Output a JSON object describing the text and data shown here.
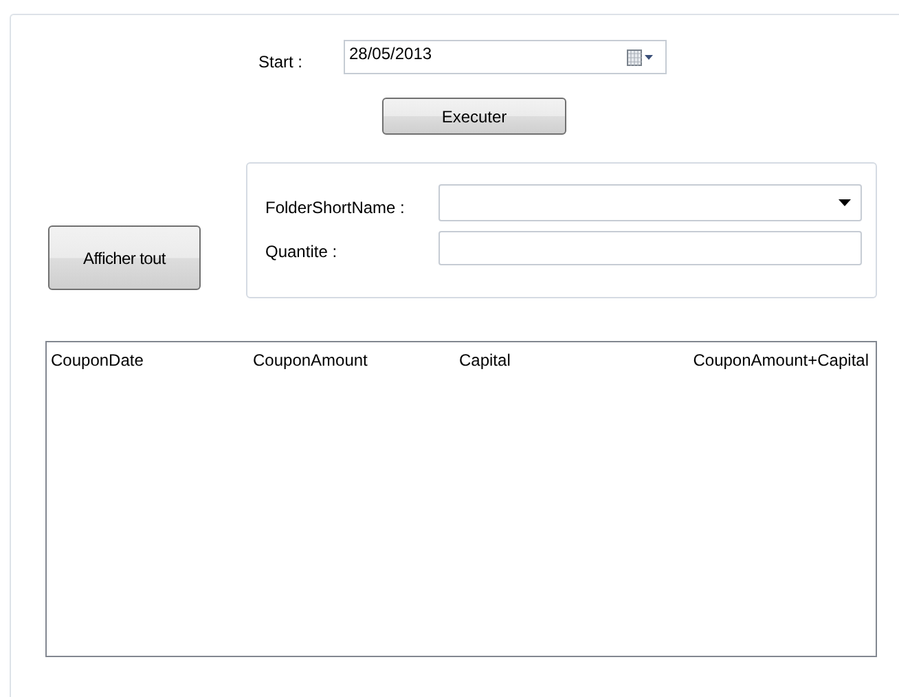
{
  "start": {
    "label": "Start :",
    "value": "28/05/2013"
  },
  "execute_button": "Executer",
  "show_all_button": "Afficher tout",
  "filter": {
    "fields": [
      {
        "kind": "combo",
        "label": "FolderShortName :"
      },
      {
        "kind": "text",
        "label": "Quantite :"
      }
    ]
  },
  "table": {
    "columns": [
      {
        "label": "CouponDate",
        "right_aligned": false
      },
      {
        "label": "CouponAmount",
        "right_aligned": false
      },
      {
        "label": "Capital",
        "right_aligned": false
      },
      {
        "label": "CouponAmount+Capital",
        "right_aligned": true
      }
    ]
  }
}
